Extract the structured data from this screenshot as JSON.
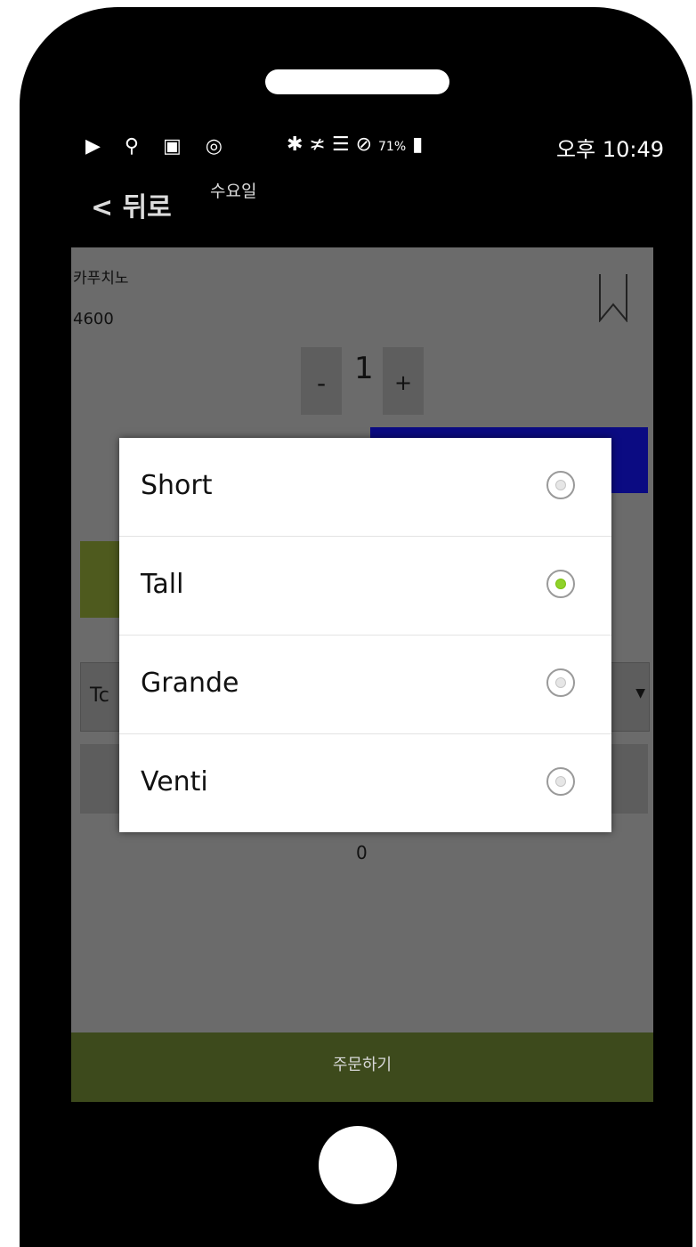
{
  "statusbar": {
    "icons": "▶ ⚲ ▣ ◎",
    "right_icons": "✱ ≭ ☰ ⊘ ",
    "battery": "71%",
    "time": "오후 10:49"
  },
  "nav": {
    "back": "< 뒤로",
    "day": "수요일"
  },
  "product": {
    "name": "카푸치노",
    "price": "4600"
  },
  "quantity": {
    "minus": "-",
    "value": "1",
    "plus": "+"
  },
  "size_select": {
    "visible_text": "Tc",
    "arrow": "▼"
  },
  "total": "0",
  "order_button": "주문하기",
  "size_dialog": {
    "options": [
      {
        "label": "Short",
        "selected": false
      },
      {
        "label": "Tall",
        "selected": true
      },
      {
        "label": "Grande",
        "selected": false
      },
      {
        "label": "Venti",
        "selected": false
      }
    ]
  },
  "colors": {
    "radio_selected": "#8fd22a",
    "order_bar": "#3d4a1c",
    "accent_blue": "#0b0b82",
    "accent_green": "#4e5a1e"
  }
}
